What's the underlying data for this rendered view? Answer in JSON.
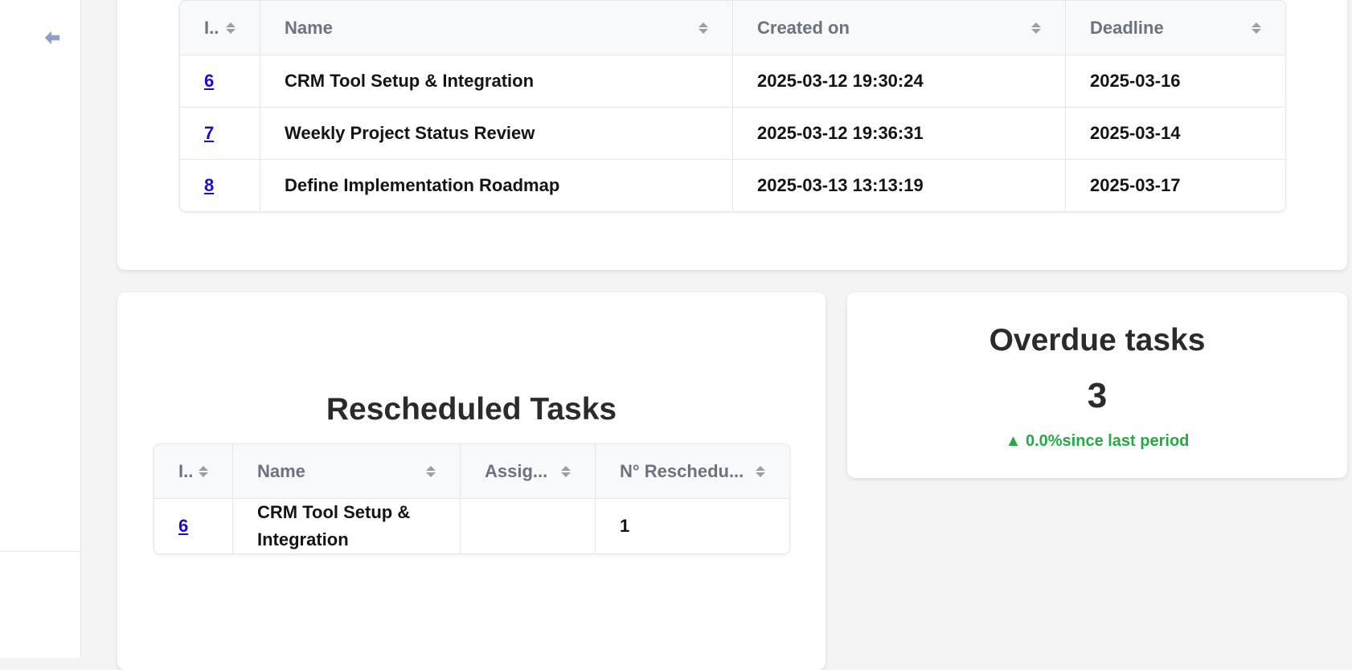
{
  "colors": {
    "accent_link": "#1a0dcc",
    "positive": "#28a745",
    "header_text": "#6b7280",
    "sidebar_icon": "#8ca1c4"
  },
  "sidebar": {
    "back_icon": "arrow-left-icon"
  },
  "tasks_table": {
    "columns": [
      "I..",
      "Name",
      "Created on",
      "Deadline"
    ],
    "rows": [
      {
        "id": "6",
        "name": "CRM Tool Setup & Integration",
        "created_on": "2025-03-12 19:30:24",
        "deadline": "2025-03-16"
      },
      {
        "id": "7",
        "name": "Weekly Project Status Review",
        "created_on": "2025-03-12 19:36:31",
        "deadline": "2025-03-14"
      },
      {
        "id": "8",
        "name": "Define Implementation Roadmap",
        "created_on": "2025-03-13 13:13:19",
        "deadline": "2025-03-17"
      }
    ]
  },
  "rescheduled": {
    "title": "Rescheduled Tasks",
    "columns": [
      "I..",
      "Name",
      "Assig...",
      "N° Reschedu..."
    ],
    "rows": [
      {
        "id": "6",
        "name": "CRM Tool Setup & Integration",
        "assignee": "",
        "count": "1"
      }
    ]
  },
  "overdue": {
    "title": "Overdue tasks",
    "value": "3",
    "change_arrow": "▲",
    "change_text": "0.0%since last period"
  }
}
